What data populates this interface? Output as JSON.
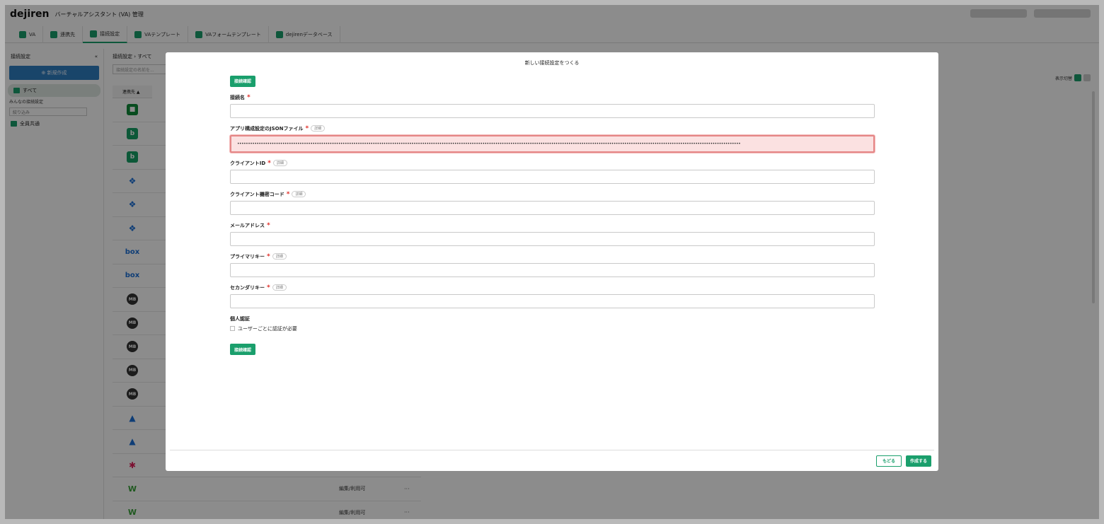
{
  "app": {
    "brand": "dejiren",
    "subtitle": "バーチャルアシスタント (VA) 管理"
  },
  "tabs": [
    {
      "label": "VA",
      "icon": "va-icon"
    },
    {
      "label": "連携先",
      "icon": "integrations-icon"
    },
    {
      "label": "接続設定",
      "icon": "connection-icon"
    },
    {
      "label": "VAテンプレート",
      "icon": "template-icon"
    },
    {
      "label": "VAフォームテンプレート",
      "icon": "form-template-icon"
    },
    {
      "label": "dejirenデータベース",
      "icon": "database-icon"
    }
  ],
  "sidebar": {
    "title": "接続設定",
    "collapse": "«",
    "new_button": "⊕ 新規作成",
    "all_label": "すべて",
    "shared_label": "みんなの接続設定",
    "filter_placeholder": "絞り込み",
    "group_label": "全員共通"
  },
  "main": {
    "breadcrumb": "接続設定 › すべて",
    "search_placeholder": "接続設定の名前を...",
    "view_toggle_label": "表示切替",
    "column_header": "連携先 ▲",
    "rows": [
      {
        "icon": "google-chat-icon",
        "glyph": "■",
        "type": "chat"
      },
      {
        "icon": "backlog-icon",
        "glyph": "b",
        "type": "b"
      },
      {
        "icon": "backlog-icon",
        "glyph": "b",
        "type": "b"
      },
      {
        "icon": "dropbox-icon",
        "glyph": "❖",
        "type": "drop"
      },
      {
        "icon": "dropbox-icon",
        "glyph": "❖",
        "type": "drop"
      },
      {
        "icon": "dropbox-icon",
        "glyph": "❖",
        "type": "drop"
      },
      {
        "icon": "box-icon",
        "glyph": "box",
        "type": "box"
      },
      {
        "icon": "box-icon",
        "glyph": "box",
        "type": "box"
      },
      {
        "icon": "mb-icon",
        "glyph": "MB",
        "type": "mb"
      },
      {
        "icon": "mb-icon",
        "glyph": "MB",
        "type": "mb"
      },
      {
        "icon": "mb-icon",
        "glyph": "MB",
        "type": "mb"
      },
      {
        "icon": "mb-icon",
        "glyph": "MB",
        "type": "mb"
      },
      {
        "icon": "mb-icon",
        "glyph": "MB",
        "type": "mb"
      },
      {
        "icon": "network-icon",
        "glyph": "▲",
        "type": "tri"
      },
      {
        "icon": "network-icon",
        "glyph": "▲",
        "type": "tri"
      },
      {
        "icon": "slack-icon",
        "glyph": "✱",
        "type": "slack"
      },
      {
        "icon": "w-icon",
        "glyph": "W",
        "type": "w",
        "perm": "編集/利用可",
        "more": "···"
      },
      {
        "icon": "w-icon",
        "glyph": "W",
        "type": "w",
        "perm": "編集/利用可",
        "more": "···"
      }
    ]
  },
  "modal": {
    "title": "新しい接続設定をつくる",
    "test_button_top": "接続確認",
    "fields": [
      {
        "label": "接続名",
        "required": "*",
        "detail": "",
        "value": "　　　　　",
        "error": false
      },
      {
        "label": "アプリ構成設定のJSONファイル",
        "required": "*",
        "detail": "詳細",
        "value": "••••••••••••••••••••••••••••••••••••••••••••••••••••••••••••••••••••••••••••••••••••••••••••••••••••••••••••••••••••••••••••••••••••••••••••••••••••••••••••••••••••••••••••••••••••••••••••••••••••••••••••••••••••••••••••••••••••••••••",
        "error": true
      },
      {
        "label": "クライアントID",
        "required": "*",
        "detail": "詳細",
        "value": "",
        "error": false
      },
      {
        "label": "クライアント機密コード",
        "required": "*",
        "detail": "詳細",
        "value": "",
        "error": false
      },
      {
        "label": "メールアドレス",
        "required": "*",
        "detail": "",
        "value": "",
        "error": false
      },
      {
        "label": "プライマリキー",
        "required": "*",
        "detail": "詳細",
        "value": "",
        "error": false
      },
      {
        "label": "セカンダリキー",
        "required": "*",
        "detail": "詳細",
        "value": "",
        "error": false
      }
    ],
    "auth_label": "個人認証",
    "auth_checkbox": "ユーザーごとに認証が必要",
    "test_button_bottom": "接続確認",
    "back_button": "もどる",
    "create_button": "作成する"
  }
}
